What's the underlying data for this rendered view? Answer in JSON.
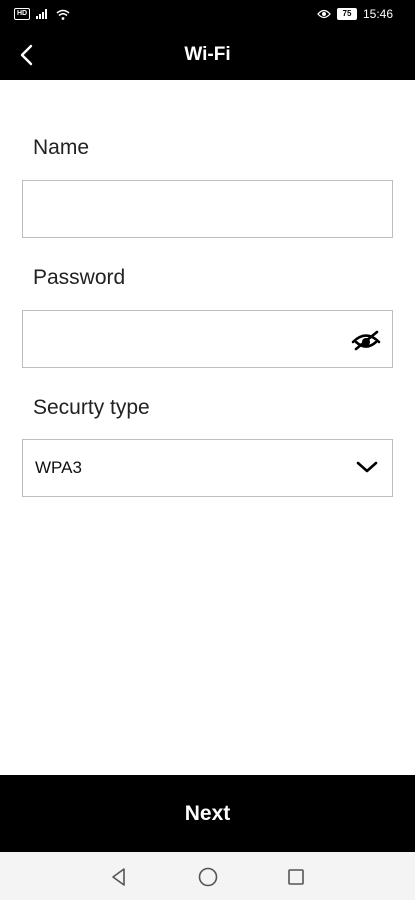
{
  "status_bar": {
    "sim_badge": "HD",
    "battery": "75",
    "time": "15:46"
  },
  "app_bar": {
    "title": "Wi-Fi"
  },
  "form": {
    "name_label": "Name",
    "name_value": "",
    "password_label": "Password",
    "password_value": "",
    "security_label": "Securty type",
    "security_value": "WPA3"
  },
  "footer": {
    "next_label": "Next"
  },
  "icons": {
    "back": "back-arrow-icon",
    "eye": "eye-slash-icon",
    "chevron": "chevron-down-icon"
  }
}
